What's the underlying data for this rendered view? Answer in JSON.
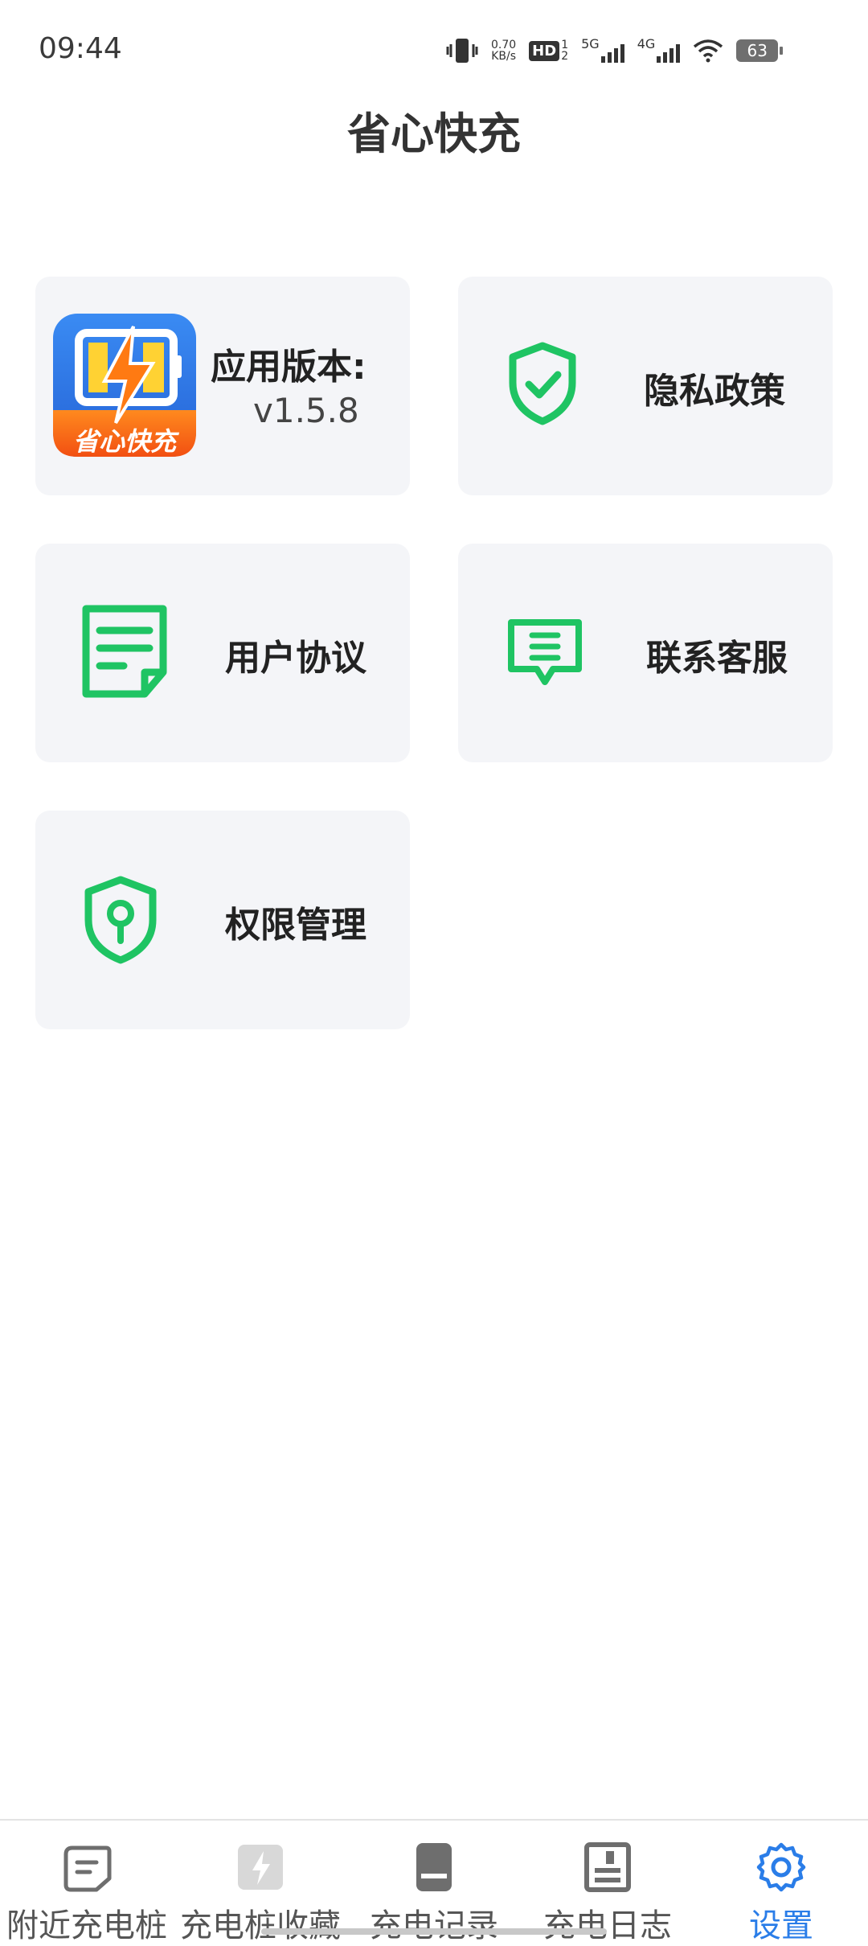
{
  "status_bar": {
    "time": "09:44",
    "net_speed_value": "0.70",
    "net_speed_unit": "KB/s",
    "hd_label": "HD",
    "hd_sub_top": "1",
    "hd_sub_bottom": "2",
    "network_5g": "5G",
    "network_4g": "4G",
    "battery": "63"
  },
  "header": {
    "title": "省心快充"
  },
  "cards": {
    "version": {
      "label": "应用版本:",
      "value": "v1.5.8",
      "logo_text": "省心快充"
    },
    "privacy": {
      "label": "隐私政策"
    },
    "agreement": {
      "label": "用户协议"
    },
    "contact": {
      "label": "联系客服"
    },
    "permissions": {
      "label": "权限管理"
    }
  },
  "bottom_nav": {
    "items": [
      {
        "label": "附近充电桩",
        "icon": "document-icon"
      },
      {
        "label": "充电桩收藏",
        "icon": "lightning-card-icon"
      },
      {
        "label": "充电记录",
        "icon": "phone-record-icon"
      },
      {
        "label": "充电日志",
        "icon": "log-icon"
      },
      {
        "label": "设置",
        "icon": "gear-icon"
      }
    ],
    "active_index": 4
  },
  "colors": {
    "accent_green": "#1fc463",
    "active_blue": "#2a7de8",
    "card_bg": "#f4f5f8",
    "icon_gray": "#6e6e6e"
  }
}
